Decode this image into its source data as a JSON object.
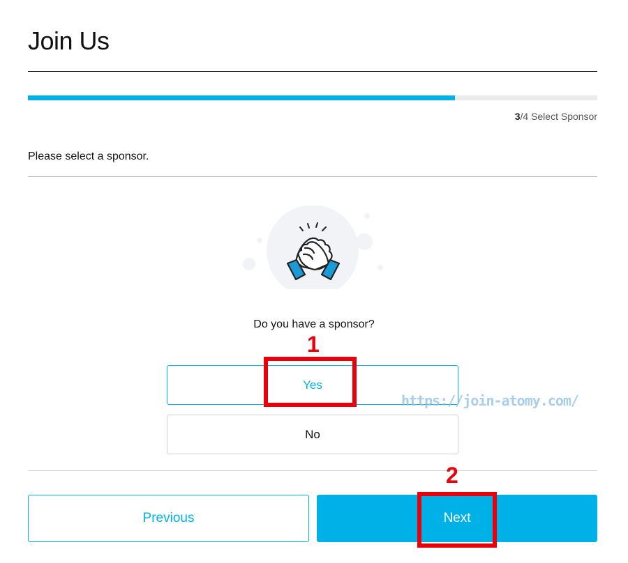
{
  "header": {
    "title": "Join Us"
  },
  "progress": {
    "fraction": 0.75,
    "current_step": "3",
    "step_suffix": "/4 Select Sponsor"
  },
  "instruction": "Please select a sponsor.",
  "illustration": {
    "icon": "handshake-icon"
  },
  "question": {
    "text": "Do you have a sponsor?",
    "options": [
      "Yes",
      "No"
    ],
    "selected": "Yes"
  },
  "footer": {
    "previous_label": "Previous",
    "next_label": "Next"
  },
  "annotations": {
    "marker_1": "1",
    "marker_2": "2",
    "color": "#e8000b"
  },
  "watermark": "https://join-atomy.com/",
  "colors": {
    "accent": "#00b1e8",
    "track": "#ebebeb"
  }
}
